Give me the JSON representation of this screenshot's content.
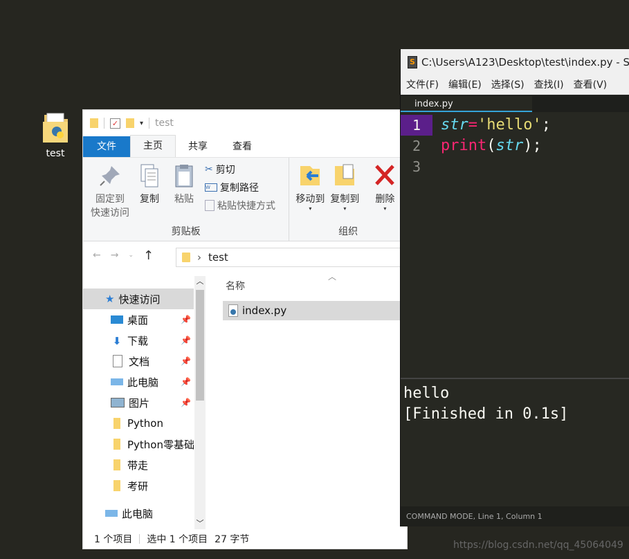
{
  "desktop": {
    "icon_label": "test"
  },
  "explorer": {
    "qat_title": "test",
    "tabs": {
      "file": "文件",
      "home": "主页",
      "share": "共享",
      "view": "查看"
    },
    "clipboard": {
      "pin_label_1": "固定到",
      "pin_label_2": "快速访问",
      "copy": "复制",
      "paste": "粘贴",
      "cut": "剪切",
      "copy_path": "复制路径",
      "paste_shortcut": "粘贴快捷方式",
      "group": "剪贴板"
    },
    "organize": {
      "move_to": "移动到",
      "copy_to": "复制到",
      "delete": "删除",
      "group": "组织"
    },
    "address": {
      "path": "test"
    },
    "nav": [
      {
        "label": "快速访问",
        "icon": "star-icon",
        "pinned": false
      },
      {
        "label": "桌面",
        "icon": "desktop-icon",
        "pinned": true
      },
      {
        "label": "下载",
        "icon": "download-icon",
        "pinned": true
      },
      {
        "label": "文档",
        "icon": "document-icon",
        "pinned": true
      },
      {
        "label": "此电脑",
        "icon": "computer-icon",
        "pinned": true
      },
      {
        "label": "图片",
        "icon": "pictures-icon",
        "pinned": true
      },
      {
        "label": "Python",
        "icon": "folder-icon",
        "pinned": false
      },
      {
        "label": "Python零基础",
        "icon": "folder-icon",
        "pinned": false
      },
      {
        "label": "带走",
        "icon": "folder-icon",
        "pinned": false
      },
      {
        "label": "考研",
        "icon": "folder-icon",
        "pinned": false
      },
      {
        "label": "此电脑",
        "icon": "computer-icon",
        "pinned": false
      }
    ],
    "column_header": "名称",
    "file": "index.py",
    "status": {
      "count": "1 个项目",
      "selected": "选中 1 个项目",
      "size": "27 字节"
    }
  },
  "sublime": {
    "title": "C:\\Users\\A123\\Desktop\\test\\index.py - S",
    "menu": [
      "文件(F)",
      "编辑(E)",
      "选择(S)",
      "查找(I)",
      "查看(V)"
    ],
    "tab": "index.py",
    "line_numbers": [
      "1",
      "2",
      "3"
    ],
    "code": {
      "l1_var": "str",
      "l1_eq": "=",
      "l1_str": "'hello'",
      "l1_semi": ";",
      "l2_fn": "print",
      "l2_open": "(",
      "l2_arg": "str",
      "l2_close": ");"
    },
    "console": [
      "hello",
      "[Finished in 0.1s]"
    ],
    "status": "COMMAND MODE, Line 1, Column 1"
  },
  "watermark": "https://blog.csdn.net/qq_45064049"
}
